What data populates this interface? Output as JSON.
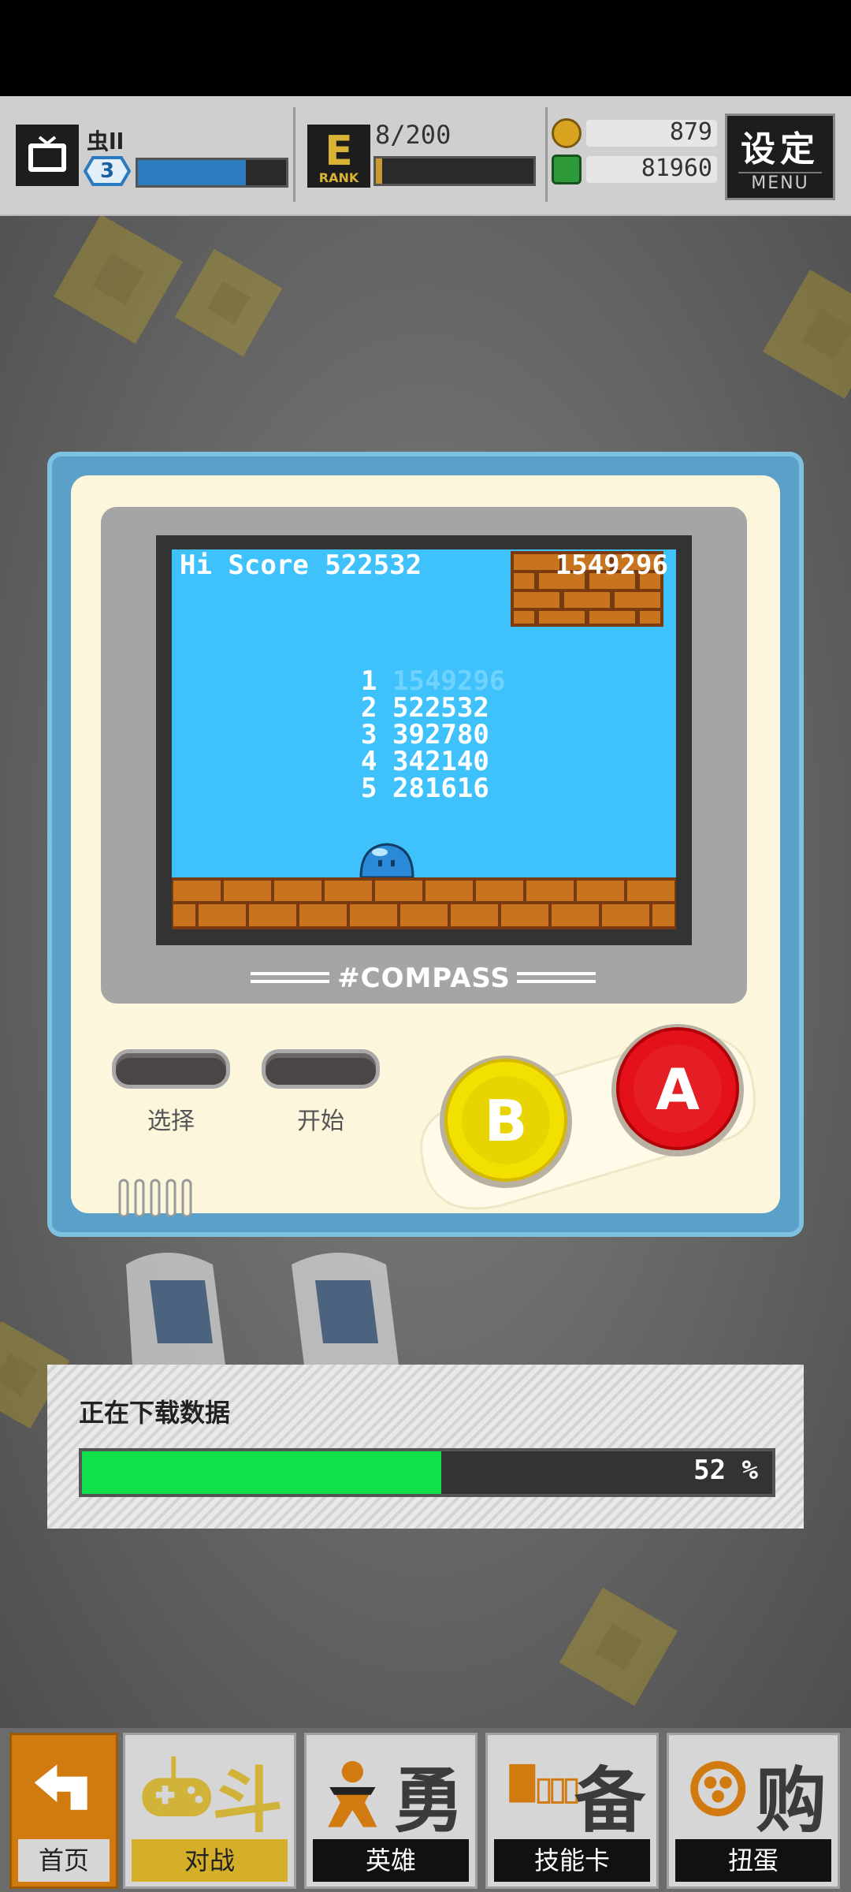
{
  "header": {
    "player_name": "虫ll",
    "player_level": "3",
    "exp_fraction": 0.73,
    "rank_letter": "E",
    "rank_word": "RANK",
    "rank_progress": "8/200",
    "rank_fraction": 0.04,
    "coins": "879",
    "gems": "81960",
    "menu_title": "设定",
    "menu_sub": "MENU"
  },
  "game_screen": {
    "hi_score": "Hi Score 522532",
    "current_score": "1549296",
    "leaderboard": [
      {
        "rank": "1",
        "score": "1549296"
      },
      {
        "rank": "2",
        "score": "522532"
      },
      {
        "rank": "3",
        "score": "392780"
      },
      {
        "rank": "4",
        "score": "342140"
      },
      {
        "rank": "5",
        "score": "281616"
      }
    ],
    "brand": "#COMPASS"
  },
  "console": {
    "select_label": "选择",
    "start_label": "开始",
    "b_label": "B",
    "a_label": "A"
  },
  "download": {
    "label": "正在下载数据",
    "percent_text": "52 %",
    "fraction": 0.52
  },
  "bottom_nav": [
    {
      "id": "home",
      "label": "首页",
      "icon": "back-arrow-icon"
    },
    {
      "id": "battle",
      "label": "对战",
      "big": "斗",
      "icon": "gamepad-icon"
    },
    {
      "id": "heroes",
      "label": "英雄",
      "big": "勇",
      "icon": "hero-icon"
    },
    {
      "id": "skill_cards",
      "label": "技能卡",
      "big": "备",
      "icon": "cards-icon"
    },
    {
      "id": "gacha",
      "label": "扭蛋",
      "big": "购",
      "icon": "capsule-icon"
    }
  ]
}
